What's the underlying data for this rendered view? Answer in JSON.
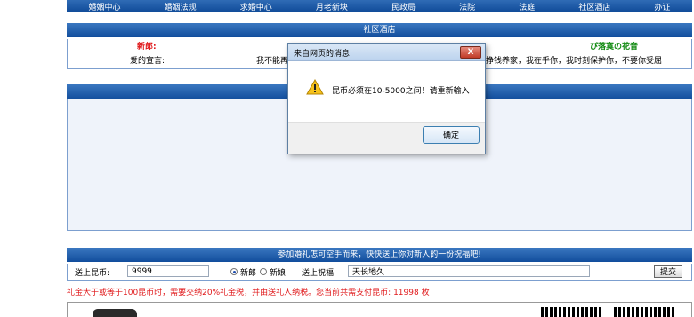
{
  "nav": [
    "婚姻中心",
    "婚姻法规",
    "求婚中心",
    "月老新块",
    "民政局",
    "法院",
    "法庭",
    "社区酒店",
    "办证"
  ],
  "hotel": {
    "header": "社区酒店",
    "groom_label": "新郎:",
    "bride_name": "ぴ落寞の花音",
    "vow_label": "爱的宣言:",
    "vow_left": "我不能再",
    "vow_right": "挣钱养家，我在乎你，我时刻保护你，不要你受屈"
  },
  "dialog": {
    "title": "来自网页的消息",
    "close": "X",
    "message": "昆币必须在10-5000之间！请重新输入",
    "ok": "确定"
  },
  "gift": {
    "header": "参加婚礼怎可空手而来，快快送上你对新人的一份祝福吧!",
    "amount_label": "送上昆币:",
    "amount_value": "9999",
    "groom_radio": "新郎",
    "bride_radio": "新娘",
    "bless_label": "送上祝福:",
    "bless_value": "天长地久",
    "submit": "提交"
  },
  "note": "礼金大于或等于100昆币时，需要交纳20%礼金税，并由送礼人纳税。您当前共需支付昆币: 11998 枚",
  "colors": {
    "nav_blue": "#0f4a98",
    "groom_red": "#e0191b",
    "bride_green": "#118a11"
  }
}
